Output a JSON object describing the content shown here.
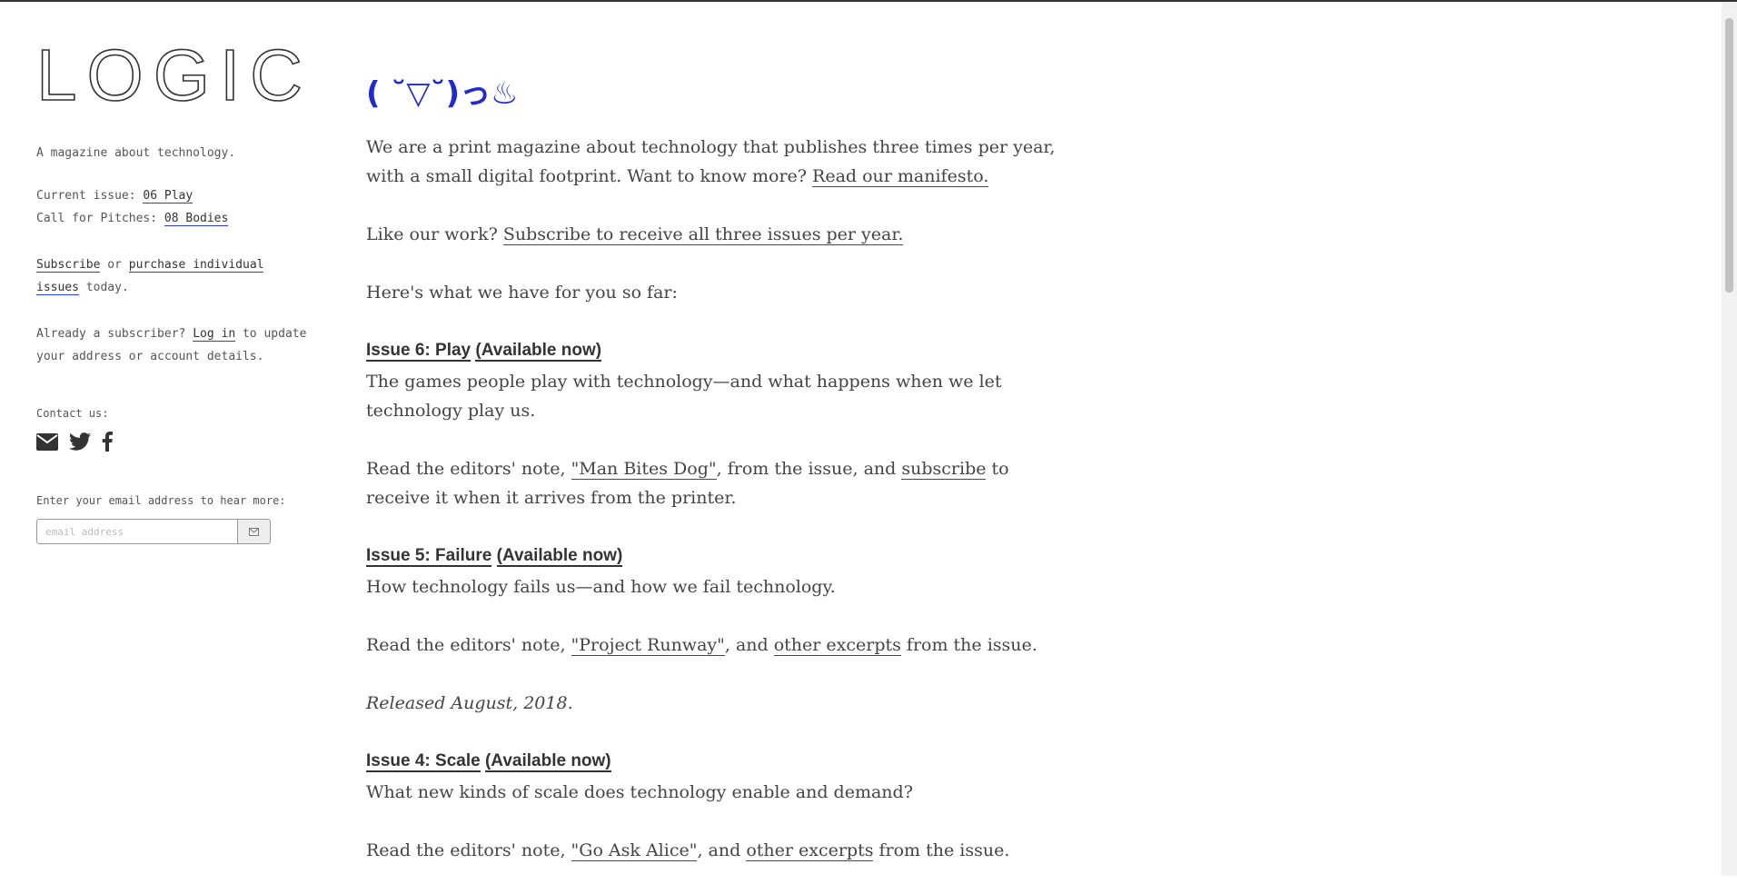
{
  "sidebar": {
    "logo": "LOGIC",
    "tagline": "A magazine about technology.",
    "current_issue_label": "Current issue:",
    "current_issue_link": "06 Play",
    "pitches_label": "Call for Pitches:",
    "pitches_link": "08 Bodies",
    "subscribe_link": "Subscribe",
    "or_text": " or ",
    "purchase_link": "purchase individual issues",
    "today_text": " today.",
    "already_text": "Already a subscriber? ",
    "login_link": "Log in",
    "update_text": " to update your address or account details.",
    "contact_label": "Contact us:",
    "social_icons": [
      "envelope-icon",
      "twitter-icon",
      "facebook-icon"
    ],
    "email_label": "Enter your email address to hear more:",
    "email_placeholder": "email address",
    "email_button_icon": "envelope-icon"
  },
  "main": {
    "kaomoji": "( ˘▽˘)っ♨",
    "intro_text": "We are a print magazine about technology that publishes three times per year, with a small digital footprint. Want to know more? ",
    "manifesto_link": "Read our manifesto.",
    "like_text": "Like our work? ",
    "subscribe_link": "Subscribe to receive all three issues per year.",
    "sofar_text": "Here's what we have for you so far:",
    "issues": [
      {
        "title": "Issue 6: Play",
        "availability": "(Available now)",
        "description": "The games people play with technology—and what happens when we let technology play us.",
        "note_prefix": "Read the editors' note, ",
        "note_link": "\"Man Bites Dog\"",
        "note_middle": ", from the issue, and ",
        "note_link2": "subscribe",
        "note_suffix": " to receive it when it arrives from the printer."
      },
      {
        "title": "Issue 5: Failure",
        "availability": "(Available now)",
        "description": "How technology fails us—and how we fail technology.",
        "note_prefix": "Read the editors' note, ",
        "note_link": "\"Project Runway\"",
        "note_middle": ", and ",
        "note_link2": "other excerpts",
        "note_suffix": " from the issue.",
        "released": "Released August, 2018."
      },
      {
        "title": "Issue 4: Scale",
        "availability": "(Available now)",
        "description": "What new kinds of scale does technology enable and demand?",
        "note_prefix": "Read the editors' note, ",
        "note_link": "\"Go Ask Alice\"",
        "note_middle": ", and ",
        "note_link2": "other excerpts",
        "note_suffix": " from the issue."
      }
    ]
  },
  "colors": {
    "link_underline": "#2b3bd6",
    "kaomoji": "#1f2bd0",
    "text": "#444444"
  }
}
